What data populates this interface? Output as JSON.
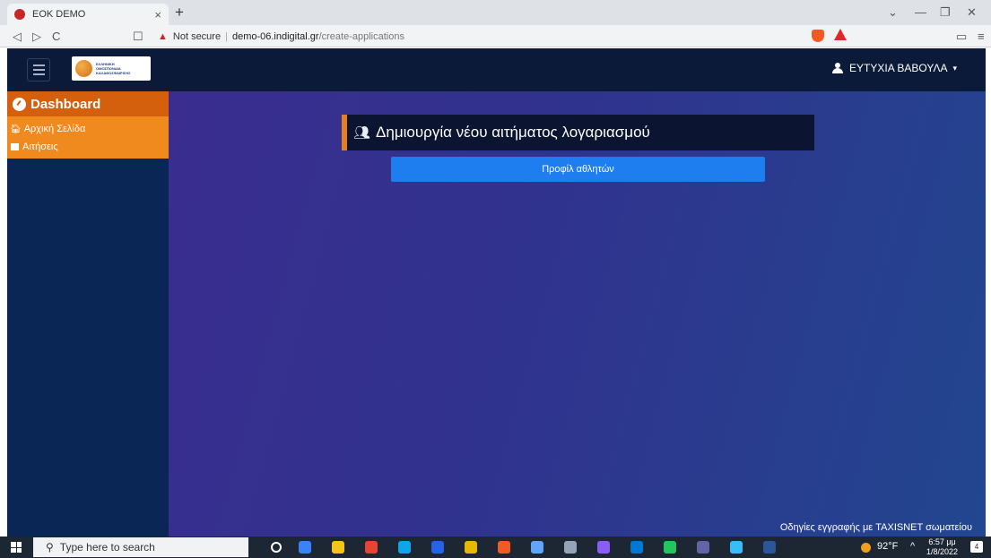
{
  "browser": {
    "tab_title": "EOK DEMO",
    "tab_close": "×",
    "new_tab": "+",
    "url_security": "Not secure",
    "url_host": "demo-06.indigital.gr",
    "url_path": "/create-applications",
    "nav_back": "◁",
    "nav_forward": "▷",
    "nav_reload": "C",
    "bookmark": "☐",
    "window_min": "—",
    "window_max": "❐",
    "window_close": "✕",
    "tab_search": "⌄",
    "menu": "≡",
    "wallet": "▭"
  },
  "app": {
    "logo_text": [
      "ΕΛΛΗΝΙΚΗ",
      "ΟΜΟΣΠΟΝΔΙΑ",
      "ΚΑΛΑΘΟΣΦΑΙΡΙΣΗΣ"
    ],
    "user_name": "ΕΥΤΥΧΙΑ ΒΑΒΟΥΛΑ",
    "user_caret": "▾"
  },
  "sidebar": {
    "dashboard": "Dashboard",
    "items": [
      {
        "label": "Αρχική Σελίδα",
        "icon": "home-icon"
      },
      {
        "label": "Αιτήσεις",
        "icon": "document-icon"
      }
    ]
  },
  "main": {
    "heading": "Δημιουργία νέου αιτήματος λογαριασμού",
    "heading_icon": "users-icon",
    "button": "Προφίλ αθλητών",
    "footer_link": "Οδηγίες εγγραφής με TAXISNET σωματείου"
  },
  "taskbar": {
    "search_placeholder": "Type here to search",
    "weather": "92°F",
    "tray_arrow": "^",
    "time": "6:57 μμ",
    "date": "1/8/2022",
    "notification_count": "4",
    "app_colors": [
      "#3b82f6",
      "#f5c518",
      "#ea4335",
      "#0ea5e9",
      "#2563eb",
      "#e6b800",
      "#f05a24",
      "#60a5fa",
      "#94a3b8",
      "#8b5cf6",
      "#0078d4",
      "#22c55e",
      "#6264a7",
      "#38bdf8",
      "#2b579a"
    ]
  }
}
